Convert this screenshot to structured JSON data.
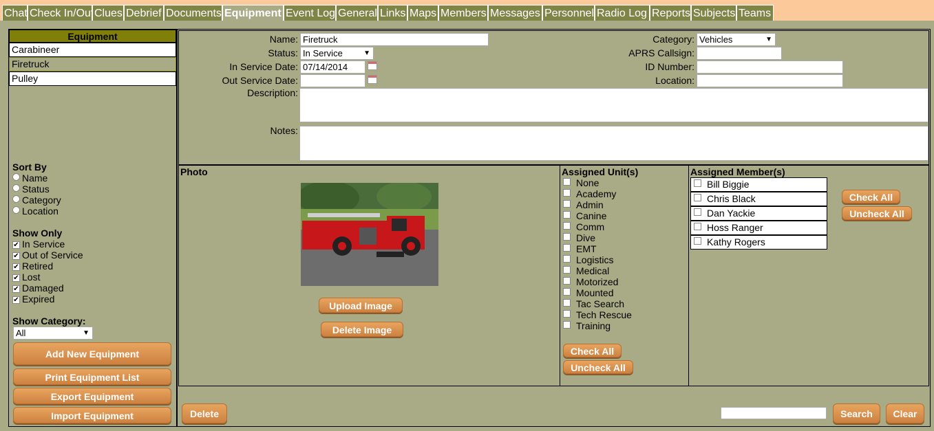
{
  "tabs": [
    "Chat",
    "Check In/Out",
    "Clues",
    "Debrief",
    "Documents",
    "Equipment",
    "Event Log",
    "General",
    "Links",
    "Maps",
    "Members",
    "Messages",
    "Personnel",
    "Radio Log",
    "Reports",
    "Subjects",
    "Teams"
  ],
  "active_tab": "Equipment",
  "sidebar": {
    "header": "Equipment",
    "items": [
      "Carabineer",
      "Firetruck",
      "Pulley"
    ],
    "selected": "Firetruck",
    "sort_by": {
      "label": "Sort By",
      "options": [
        "Name",
        "Status",
        "Category",
        "Location"
      ]
    },
    "show_only": {
      "label": "Show Only",
      "options": [
        "In Service",
        "Out of Service",
        "Retired",
        "Lost",
        "Damaged",
        "Expired"
      ]
    },
    "show_category": {
      "label": "Show Category:",
      "value": "All"
    },
    "buttons": {
      "add": "Add New Equipment",
      "print": "Print Equipment List",
      "export": "Export Equipment",
      "import": "Import Equipment"
    }
  },
  "form": {
    "name_label": "Name:",
    "name_value": "Firetruck",
    "status_label": "Status:",
    "status_value": "In Service",
    "in_service_label": "In Service Date:",
    "in_service_value": "07/14/2014",
    "out_service_label": "Out Service Date:",
    "out_service_value": "",
    "description_label": "Description:",
    "description_value": "",
    "notes_label": "Notes:",
    "notes_value": "",
    "category_label": "Category:",
    "category_value": "Vehicles",
    "aprs_label": "APRS Callsign:",
    "aprs_value": "",
    "id_label": "ID Number:",
    "id_value": "",
    "location_label": "Location:",
    "location_value": ""
  },
  "photo": {
    "label": "Photo",
    "upload": "Upload Image",
    "delete": "Delete Image"
  },
  "units": {
    "label": "Assigned Unit(s)",
    "options": [
      "None",
      "Academy",
      "Admin",
      "Canine",
      "Comm",
      "Dive",
      "EMT",
      "Logistics",
      "Medical",
      "Motorized",
      "Mounted",
      "Tac Search",
      "Tech Rescue",
      "Training"
    ],
    "check_all": "Check All",
    "uncheck_all": "Uncheck All"
  },
  "members": {
    "label": "Assigned Member(s)",
    "options": [
      "Bill Biggie",
      "Chris Black",
      "Dan Yackie",
      "Hoss Ranger",
      "Kathy Rogers"
    ],
    "check_all": "Check All",
    "uncheck_all": "Uncheck All"
  },
  "footer": {
    "delete": "Delete",
    "search_value": "",
    "search": "Search",
    "clear": "Clear"
  },
  "colors": {
    "panel_bg": "#a8ab85",
    "tab_bg": "#7f8447",
    "tabbar_bg": "#fbc99a",
    "button": "#d98b48",
    "header_bg": "#7f7f0a"
  }
}
